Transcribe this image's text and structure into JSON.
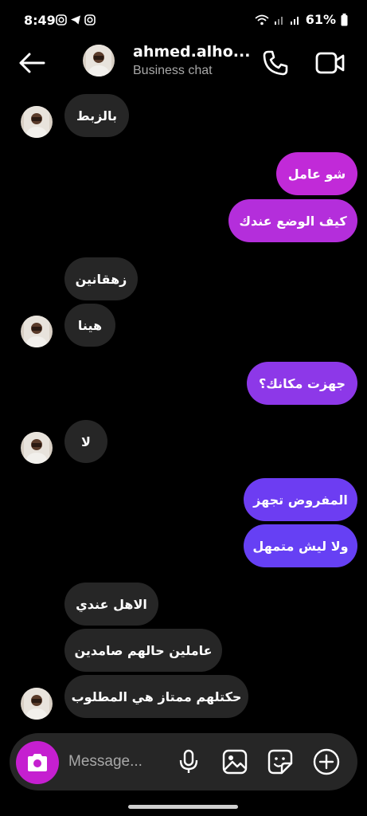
{
  "status_bar": {
    "time": "8:49",
    "battery": "61%"
  },
  "header": {
    "name": "ahmed.alho...",
    "subtitle": "Business chat"
  },
  "messages": [
    {
      "text": "بالزبط",
      "dir": "in"
    },
    {
      "text": "شو عامل",
      "dir": "out"
    },
    {
      "text": "كيف الوضع عندك",
      "dir": "out"
    },
    {
      "text": "زهقانين",
      "dir": "in"
    },
    {
      "text": "هينا",
      "dir": "in"
    },
    {
      "text": "جهزت مكانك؟",
      "dir": "out"
    },
    {
      "text": "لا",
      "dir": "in"
    },
    {
      "text": "المفروض تجهز",
      "dir": "out"
    },
    {
      "text": "ولا ليش متمهل",
      "dir": "out"
    },
    {
      "text": "الاهل عندي",
      "dir": "in"
    },
    {
      "text": "عاملين حالهم صامدين",
      "dir": "in"
    },
    {
      "text": "حكتلهم ممتاز هي المطلوب",
      "dir": "in"
    }
  ],
  "composer": {
    "placeholder": "Message..."
  },
  "colors": {
    "outgoing_top": "#c22bd9",
    "outgoing_bottom": "#6b3ff5",
    "incoming": "#262626",
    "camera": "#c51fd0"
  },
  "icons": [
    "back-arrow-icon",
    "phone-icon",
    "video-camera-icon",
    "camera-icon",
    "microphone-icon",
    "gallery-icon",
    "sticker-icon",
    "plus-icon"
  ]
}
